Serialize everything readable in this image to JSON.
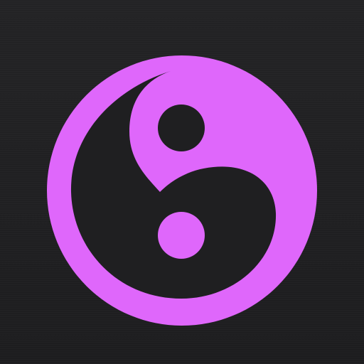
{
  "icon": {
    "name": "yin-yang-icon",
    "background_color": "#1f1f21",
    "accent_color": "#df67fb"
  }
}
